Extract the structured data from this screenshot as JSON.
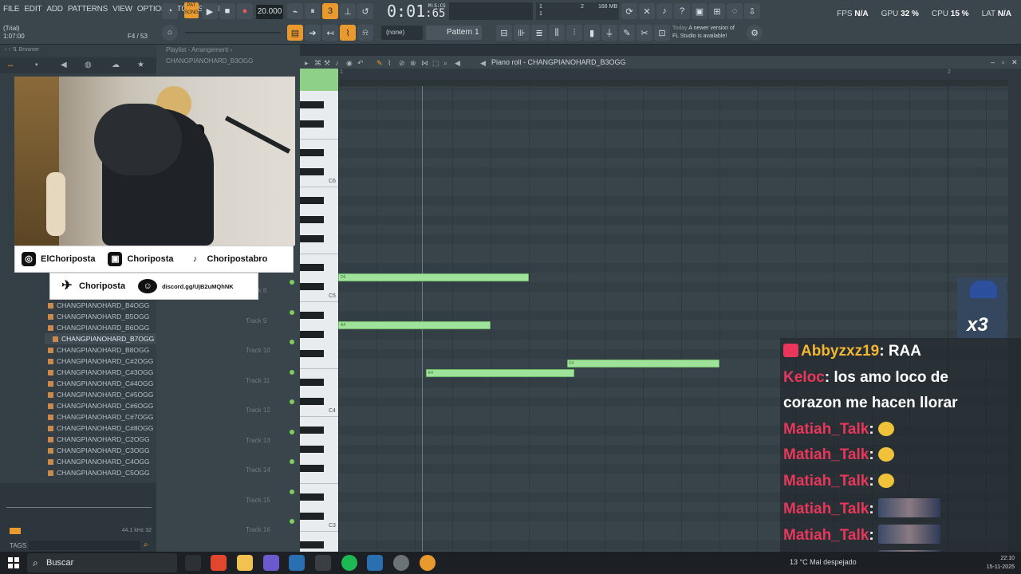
{
  "menu": [
    "FILE",
    "EDIT",
    "ADD",
    "PATTERNS",
    "VIEW",
    "OPTIONS",
    "TOOLS",
    "HELP"
  ],
  "hint": {
    "title": "(Trial)",
    "time": "1:07:00",
    "position": "F4 / 53"
  },
  "transport": {
    "pat_label": "PAT\nSONG",
    "bpm": "20.000",
    "time": "0:01",
    "time_fraction": ":65",
    "time_unit": "M:S:CS",
    "memory": "166 MB",
    "mem_line1": "1",
    "mem_line2": "1",
    "mem_num": "2"
  },
  "stats": {
    "fps_label": "FPS",
    "fps": "N/A",
    "gpu_label": "GPU",
    "gpu": "32 %",
    "cpu_label": "CPU",
    "cpu": "15 %",
    "lat_label": "LAT",
    "lat": "N/A"
  },
  "toolbar2": {
    "none_label": "(none)",
    "pattern": "Pattern 1"
  },
  "news": {
    "today": "Today",
    "line1": "A newer version of",
    "line2": "FL Studio is available!"
  },
  "browser": {
    "title": "Browser"
  },
  "files": [
    {
      "name": "CHANGPIANOHARD_B4OGG",
      "selected": false
    },
    {
      "name": "CHANGPIANOHARD_B5OGG",
      "selected": false
    },
    {
      "name": "CHANGPIANOHARD_B6OGG",
      "selected": false
    },
    {
      "name": "CHANGPIANOHARD_B7OGG",
      "selected": true
    },
    {
      "name": "CHANGPIANOHARD_B8OGG",
      "selected": false
    },
    {
      "name": "CHANGPIANOHARD_C#2OGG",
      "selected": false
    },
    {
      "name": "CHANGPIANOHARD_C#3OGG",
      "selected": false
    },
    {
      "name": "CHANGPIANOHARD_C#4OGG",
      "selected": false
    },
    {
      "name": "CHANGPIANOHARD_C#5OGG",
      "selected": false
    },
    {
      "name": "CHANGPIANOHARD_C#6OGG",
      "selected": false
    },
    {
      "name": "CHANGPIANOHARD_C#7OGG",
      "selected": false
    },
    {
      "name": "CHANGPIANOHARD_C#8OGG",
      "selected": false
    },
    {
      "name": "CHANGPIANOHARD_C2OGG",
      "selected": false
    },
    {
      "name": "CHANGPIANOHARD_C3OGG",
      "selected": false
    },
    {
      "name": "CHANGPIANOHARD_C4OGG",
      "selected": false
    },
    {
      "name": "CHANGPIANOHARD_C5OGG",
      "selected": false
    }
  ],
  "left_bottom": {
    "tags": "TAGS",
    "rate": "44.1 kHz 32"
  },
  "playlist": {
    "title": "Playlist - Arrangement",
    "pattern": "CHANGPIANOHARD_B3OGG",
    "tracks": [
      "Track 8",
      "Track 9",
      "Track 10",
      "Track 11",
      "Track 12",
      "Track 13",
      "Track 14",
      "Track 15",
      "Track 16"
    ]
  },
  "piano_roll": {
    "title": "Piano roll - CHANGPIANOHARD_B3OGG",
    "ruler": [
      "1",
      "2"
    ],
    "key_labels": [
      "C6",
      "C5",
      "C4",
      "C3"
    ],
    "notes": [
      {
        "label": "D5",
        "start_beat": 0.0,
        "length_beats": 2.5
      },
      {
        "label": "A4",
        "start_beat": 0.0,
        "length_beats": 2.0
      },
      {
        "label": "E4",
        "start_beat": 1.15,
        "length_beats": 1.95
      },
      {
        "label": "F4",
        "start_beat": 3.0,
        "length_beats": 2.0
      }
    ]
  },
  "socials": {
    "instagram": "ElChoriposta",
    "kick": "Choriposta",
    "tiktok": "Choripostabro",
    "twitter": "Choriposta",
    "discord": "discord.gg/UjB2uMQhNK"
  },
  "sub_badge": "x3",
  "chat": [
    {
      "user": "Abbyzxz19",
      "msg": "RAA",
      "color": "gold",
      "heart": true
    },
    {
      "user": "Keloc",
      "msg": "los amo loco de",
      "color": "red"
    },
    {
      "user": "",
      "msg": "corazon me hacen llorar",
      "color": "red"
    },
    {
      "user": "Matiah_Talk",
      "msg": "",
      "color": "red",
      "emote": "small"
    },
    {
      "user": "Matiah_Talk",
      "msg": "",
      "color": "red",
      "emote": "small"
    },
    {
      "user": "Matiah_Talk",
      "msg": "",
      "color": "red",
      "emote": "small"
    },
    {
      "user": "Matiah_Talk",
      "msg": "",
      "color": "red",
      "emote": "wide"
    },
    {
      "user": "Matiah_Talk",
      "msg": "",
      "color": "red",
      "emote": "wide"
    },
    {
      "user": "Matiah_Talk",
      "msg": "",
      "color": "red",
      "emote": "wide"
    }
  ],
  "taskbar": {
    "search": "Buscar",
    "weather": "Mal despejado",
    "temp": "13 °C",
    "time": "22:10",
    "date": "15-11-2025"
  }
}
